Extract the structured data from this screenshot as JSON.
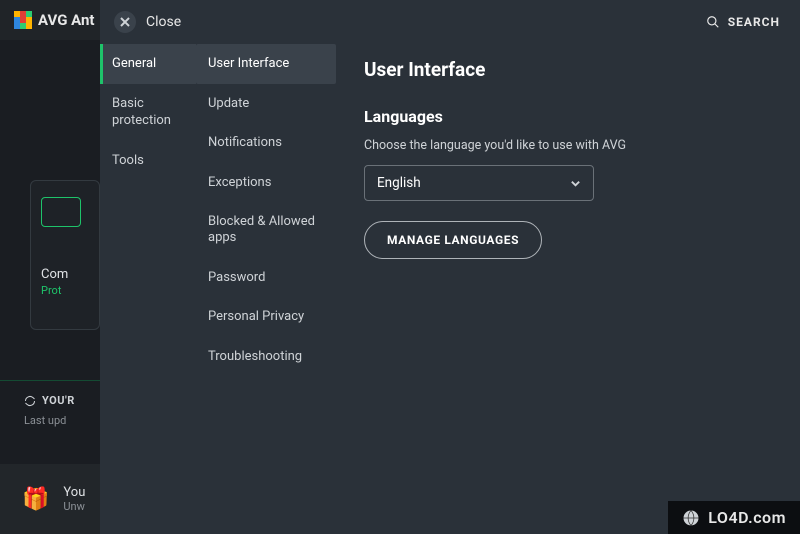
{
  "bg": {
    "app_name": "AVG Ant",
    "card": {
      "title": "Com",
      "subtitle": "Prot"
    },
    "status_label": "YOU'R",
    "last_update_label": "Last upd",
    "banner": {
      "title": "You",
      "subtitle": "Unw"
    }
  },
  "overlay": {
    "close_label": "Close",
    "search_label": "SEARCH"
  },
  "nav1": {
    "items": [
      {
        "label": "General",
        "active": true
      },
      {
        "label": "Basic protection",
        "active": false
      },
      {
        "label": "Tools",
        "active": false
      }
    ]
  },
  "nav2": {
    "items": [
      {
        "label": "User Interface",
        "active": true
      },
      {
        "label": "Update",
        "active": false
      },
      {
        "label": "Notifications",
        "active": false
      },
      {
        "label": "Exceptions",
        "active": false
      },
      {
        "label": "Blocked & Allowed apps",
        "active": false
      },
      {
        "label": "Password",
        "active": false
      },
      {
        "label": "Personal Privacy",
        "active": false
      },
      {
        "label": "Troubleshooting",
        "active": false
      }
    ]
  },
  "content": {
    "page_title": "User Interface",
    "section_title": "Languages",
    "helptext": "Choose the language you'd like to use with AVG",
    "language_value": "English",
    "manage_button": "MANAGE LANGUAGES"
  },
  "watermark": {
    "text": "LO4D.com"
  }
}
